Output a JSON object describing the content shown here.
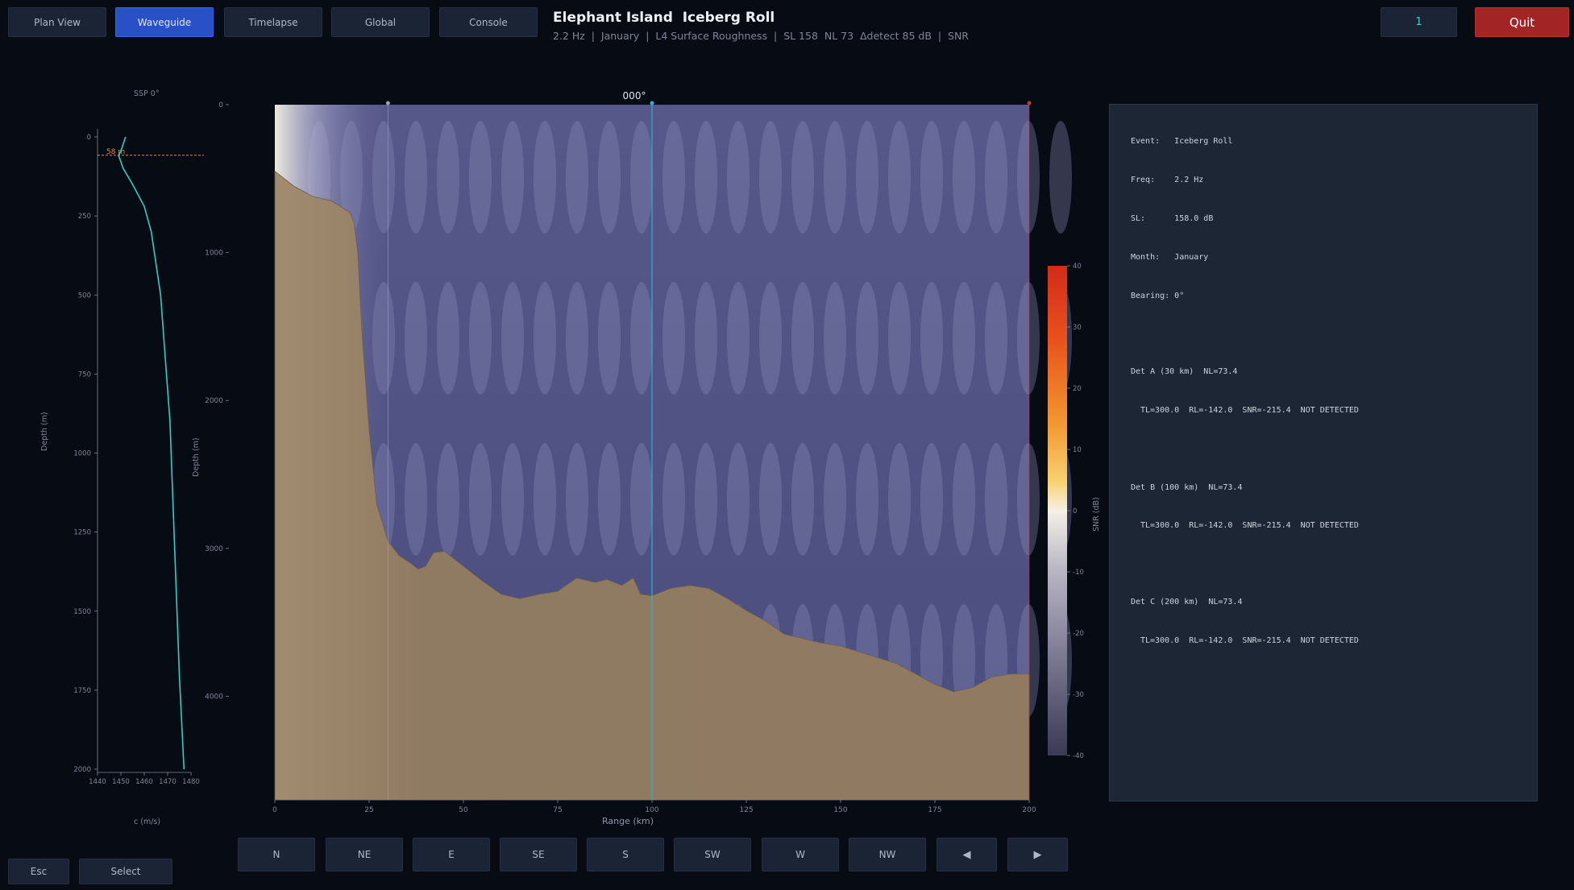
{
  "top_tabs": [
    {
      "label": "Plan View",
      "active": false
    },
    {
      "label": "Waveguide",
      "active": true
    },
    {
      "label": "Timelapse",
      "active": false
    },
    {
      "label": "Global",
      "active": false
    },
    {
      "label": "Console",
      "active": false
    }
  ],
  "header": {
    "title": "Elephant Island  Iceberg Roll",
    "subtitle": "2.2 Hz  |  January  |  L4 Surface Roughness  |  SL 158  NL 73  Δdetect 85 dB  |  SNR"
  },
  "top_right": {
    "index_label": "1",
    "quit_label": "Quit"
  },
  "ssp": {
    "title": "SSP 0°",
    "ylabel": "Depth (m)",
    "xlabel": "c (m/s)",
    "depth_ticks": [
      0,
      250,
      500,
      750,
      1000,
      1250,
      1500,
      1750,
      2000
    ],
    "speed_ticks": [
      1440,
      1450,
      1460,
      1470,
      1480
    ],
    "mld_label": "58 m",
    "mld_depth": 58,
    "profile": [
      [
        1452,
        0
      ],
      [
        1450,
        45
      ],
      [
        1449,
        58
      ],
      [
        1451,
        100
      ],
      [
        1455,
        150
      ],
      [
        1460,
        220
      ],
      [
        1463,
        300
      ],
      [
        1465,
        400
      ],
      [
        1467,
        500
      ],
      [
        1469,
        700
      ],
      [
        1471,
        900
      ],
      [
        1472,
        1100
      ],
      [
        1473,
        1300
      ],
      [
        1474,
        1500
      ],
      [
        1475,
        1700
      ],
      [
        1477,
        2000
      ]
    ],
    "colors": {
      "profile": "#2fd0c3",
      "mld": "#e88a2a"
    }
  },
  "section": {
    "bearing_label": "000°",
    "xlabel": "Range (km)",
    "ylabel": "Depth (m)",
    "x_ticks": [
      0,
      25,
      50,
      75,
      100,
      125,
      150,
      175,
      200
    ],
    "depth_ticks": [
      0,
      1000,
      2000,
      3000,
      4000
    ],
    "xlim": [
      0,
      200
    ],
    "ylim": [
      0,
      4700
    ],
    "bathymetry": [
      [
        0,
        450
      ],
      [
        5,
        550
      ],
      [
        10,
        620
      ],
      [
        15,
        650
      ],
      [
        20,
        730
      ],
      [
        21,
        800
      ],
      [
        22,
        1000
      ],
      [
        23,
        1500
      ],
      [
        25,
        2200
      ],
      [
        27,
        2700
      ],
      [
        30,
        2950
      ],
      [
        33,
        3050
      ],
      [
        36,
        3100
      ],
      [
        38,
        3140
      ],
      [
        40,
        3120
      ],
      [
        42,
        3030
      ],
      [
        45,
        3020
      ],
      [
        50,
        3120
      ],
      [
        55,
        3220
      ],
      [
        60,
        3310
      ],
      [
        65,
        3340
      ],
      [
        70,
        3310
      ],
      [
        75,
        3290
      ],
      [
        80,
        3200
      ],
      [
        85,
        3230
      ],
      [
        88,
        3210
      ],
      [
        92,
        3250
      ],
      [
        95,
        3200
      ],
      [
        97,
        3310
      ],
      [
        100,
        3320
      ],
      [
        105,
        3270
      ],
      [
        110,
        3250
      ],
      [
        115,
        3270
      ],
      [
        120,
        3340
      ],
      [
        125,
        3420
      ],
      [
        130,
        3490
      ],
      [
        135,
        3580
      ],
      [
        140,
        3610
      ],
      [
        145,
        3640
      ],
      [
        150,
        3660
      ],
      [
        155,
        3700
      ],
      [
        160,
        3740
      ],
      [
        165,
        3780
      ],
      [
        170,
        3850
      ],
      [
        175,
        3920
      ],
      [
        180,
        3970
      ],
      [
        185,
        3940
      ],
      [
        190,
        3870
      ],
      [
        195,
        3850
      ],
      [
        200,
        3850
      ]
    ],
    "markers": [
      {
        "range": 30
      },
      {
        "range": 100
      },
      {
        "range": 200
      }
    ],
    "colors": {
      "water": "#4a4d7d",
      "seabed": "#907b62",
      "marker_mid": "#2fb2c7",
      "marker_edge": "#c23a3a"
    }
  },
  "colorbar": {
    "label": "SNR (dB)",
    "ticks": [
      40,
      30,
      20,
      10,
      0,
      -10,
      -20,
      -30,
      -40
    ],
    "range": [
      -40,
      40
    ]
  },
  "info": {
    "event": "Event:   Iceberg Roll",
    "freq": "Freq:    2.2 Hz",
    "sl": "SL:      158.0 dB",
    "month": "Month:   January",
    "bearing": "Bearing: 0°",
    "detectors": [
      {
        "header": "Det A (30 km)  NL=73.4",
        "result": "TL=300.0  RL=-142.0  SNR=-215.4  NOT DETECTED"
      },
      {
        "header": "Det B (100 km)  NL=73.4",
        "result": "TL=300.0  RL=-142.0  SNR=-215.4  NOT DETECTED"
      },
      {
        "header": "Det C (200 km)  NL=73.4",
        "result": "TL=300.0  RL=-142.0  SNR=-215.4  NOT DETECTED"
      }
    ]
  },
  "compass_buttons": [
    "N",
    "NE",
    "E",
    "SE",
    "S",
    "SW",
    "W",
    "NW"
  ],
  "nav_buttons": {
    "prev": "◀",
    "next": "▶"
  },
  "bottom_left": {
    "esc": "Esc",
    "select": "Select"
  }
}
